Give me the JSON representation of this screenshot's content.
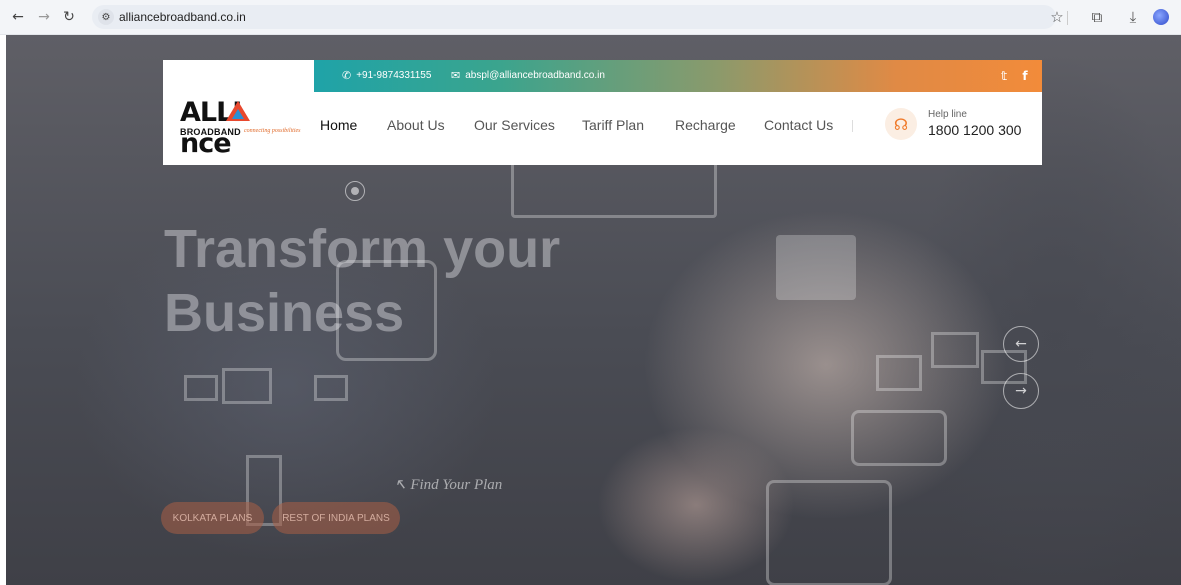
{
  "browser": {
    "url": "alliancebroadband.co.in",
    "icons": [
      "back-icon",
      "forward-icon",
      "reload-icon",
      "site-settings-icon",
      "bookmark-star-icon",
      "extensions-icon",
      "download-icon",
      "profile-avatar"
    ]
  },
  "topbar": {
    "phone": "+91-9874331155",
    "email": "abspl@alliancebroadband.co.in",
    "social": [
      "twitter-icon",
      "facebook-icon"
    ],
    "gradient": [
      "#1fa3a8",
      "#f28b3a"
    ]
  },
  "logo": {
    "word": "ALLIANCE",
    "wordmark_left": "ALLI",
    "wordmark_right": "nce",
    "subtitle": "BROADBAND",
    "tagline": "connecting possibilities"
  },
  "nav": {
    "items": [
      "Home",
      "About Us",
      "Our Services",
      "Tariff Plan",
      "Recharge",
      "Contact Us"
    ],
    "active": "Home"
  },
  "helpline": {
    "label": "Help line",
    "number": "1800 1200 300",
    "accent": "#f07a2a"
  },
  "hero": {
    "title_line1": "Transform your",
    "title_line2": "Business",
    "find_plan": "Find Your Plan",
    "buttons": [
      "KOLKATA PLANS",
      "REST OF INDIA PLANS"
    ]
  }
}
